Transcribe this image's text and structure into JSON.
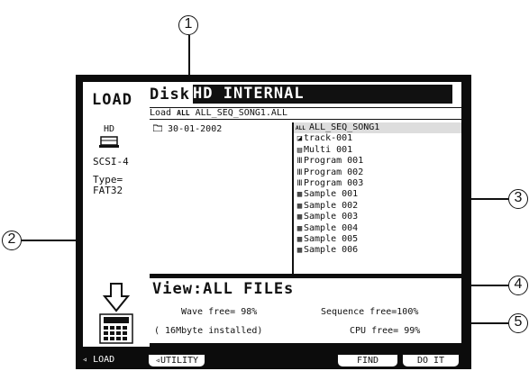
{
  "left_panel": {
    "title": "LOAD",
    "device": "HD",
    "bus": "SCSI-4",
    "type_label": "Type=",
    "type_value": "FAT32"
  },
  "disk": {
    "label": "Disk:",
    "value": "HD INTERNAL"
  },
  "browser": {
    "path_prefix": "Load",
    "path_name": "ALL_SEQ_SONG1.ALL",
    "folder": "30-01-2002",
    "files": [
      {
        "icon": "all-icon",
        "name": "ALL_SEQ_SONG1"
      },
      {
        "icon": "track-icon",
        "name": "track-001"
      },
      {
        "icon": "multi-icon",
        "name": "Multi 001"
      },
      {
        "icon": "program-icon",
        "name": "Program 001"
      },
      {
        "icon": "program-icon",
        "name": "Program 002"
      },
      {
        "icon": "program-icon",
        "name": "Program 003"
      },
      {
        "icon": "sample-icon",
        "name": "Sample 001"
      },
      {
        "icon": "sample-icon",
        "name": "Sample 002"
      },
      {
        "icon": "sample-icon",
        "name": "Sample 003"
      },
      {
        "icon": "sample-icon",
        "name": "Sample 004"
      },
      {
        "icon": "sample-icon",
        "name": "Sample 005"
      },
      {
        "icon": "sample-icon",
        "name": "Sample 006"
      }
    ]
  },
  "view": {
    "text": "View:ALL FILEs"
  },
  "status": {
    "wave_free": "Wave free= 98%",
    "sequence_free": "Sequence free=100%",
    "installed": "( 16Mbyte installed)",
    "cpu_free": "CPU free= 99%"
  },
  "function_bar": {
    "load": "LOAD",
    "utility": "UTILITY",
    "find": "FIND",
    "do_it": "DO IT"
  },
  "callouts": [
    "1",
    "2",
    "3",
    "4",
    "5"
  ]
}
